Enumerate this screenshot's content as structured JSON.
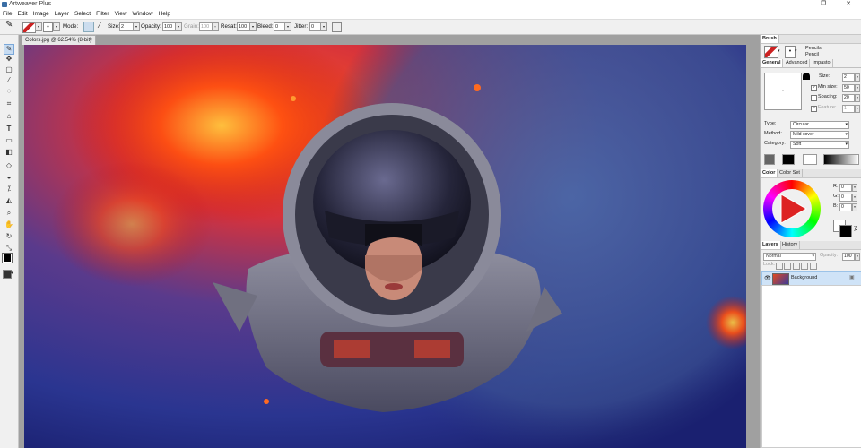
{
  "app": {
    "title": "Artweaver Plus"
  },
  "window_controls": {
    "minimize": "—",
    "maximize": "❐",
    "close": "✕"
  },
  "menu": [
    "File",
    "Edit",
    "Image",
    "Layer",
    "Select",
    "Filter",
    "View",
    "Window",
    "Help"
  ],
  "toolbar": {
    "mode_label": "Mode:",
    "size_label": "Size:",
    "size_value": "2",
    "opacity_label": "Opacity:",
    "opacity_value": "100",
    "grain_label": "Grain:",
    "grain_value": "100",
    "resat_label": "Resat:",
    "resat_value": "100",
    "bleed_label": "Bleed:",
    "bleed_value": "0",
    "jitter_label": "Jitter:",
    "jitter_value": "0"
  },
  "document": {
    "tab": "Colors.jpg @ 62.54% (8-bit)",
    "close": "×"
  },
  "brush_panel": {
    "title": "Brush",
    "category": "Pencils",
    "variant": "Pencil",
    "tabs": [
      "General",
      "Advanced",
      "Impasto"
    ],
    "size_label": "Size:",
    "size_value": "2",
    "min_size_label": "Min size:",
    "min_size_value": "50",
    "spacing_label": "Spacing:",
    "spacing_value": "20",
    "feature_label": "Feature:",
    "feature_value": "1",
    "type_label": "Type:",
    "type_value": "Circular",
    "method_label": "Method:",
    "method_value": "Mild cover",
    "category_label": "Category:",
    "category_value": "Soft"
  },
  "color_panel": {
    "tabs": [
      "Color",
      "Color Set"
    ],
    "r_label": "R:",
    "r_value": "0",
    "g_label": "G:",
    "g_value": "0",
    "b_label": "B:",
    "b_value": "0"
  },
  "layers_panel": {
    "tabs": [
      "Layers",
      "History"
    ],
    "blend_mode": "Normal",
    "opacity_label": "Opacity:",
    "opacity_value": "100",
    "lock_label": "Lock:",
    "layer_name": "Background"
  },
  "colors": {
    "accent_blue": "#3a6ea5",
    "layer_selected": "#cfe3f7"
  }
}
